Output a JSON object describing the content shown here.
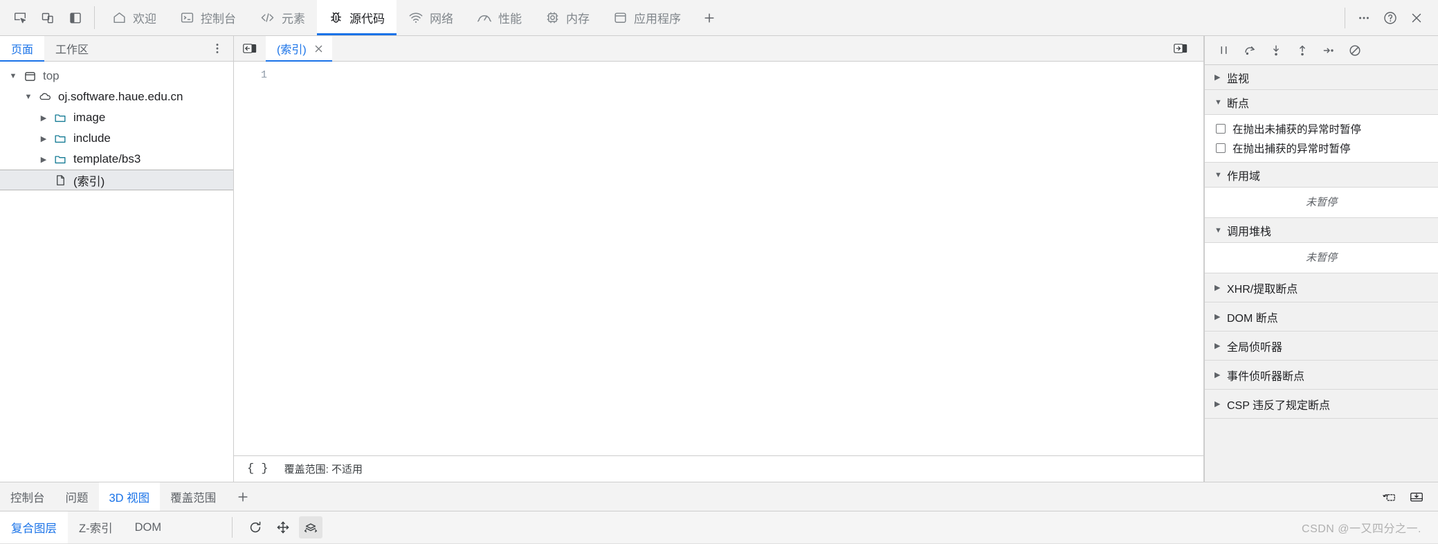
{
  "window": {
    "device_toolbar_icons": [
      "inspect-element-icon",
      "device-toolbar-icon",
      "dock-side-icon"
    ],
    "more_label": "⋯",
    "help_label": "?",
    "close_label": "×"
  },
  "panel_tabs": [
    {
      "label": "欢迎",
      "icon": "home-icon",
      "active": false
    },
    {
      "label": "控制台",
      "icon": "console-icon",
      "active": false
    },
    {
      "label": "元素",
      "icon": "elements-icon",
      "active": false
    },
    {
      "label": "源代码",
      "icon": "sources-bug-icon",
      "active": true
    },
    {
      "label": "网络",
      "icon": "network-wifi-icon",
      "active": false
    },
    {
      "label": "性能",
      "icon": "performance-gauge-icon",
      "active": false
    },
    {
      "label": "内存",
      "icon": "memory-chip-icon",
      "active": false
    },
    {
      "label": "应用程序",
      "icon": "application-icon",
      "active": false
    }
  ],
  "add_panel_label": "+",
  "navigator": {
    "tabs": [
      {
        "label": "页面",
        "active": true
      },
      {
        "label": "工作区",
        "active": false
      }
    ],
    "kebab_label": "⋮",
    "tree": [
      {
        "label": "top",
        "icon": "frame-icon",
        "twisty": "▼",
        "indent": 0,
        "selected": false,
        "muted": true
      },
      {
        "label": "oj.software.haue.edu.cn",
        "icon": "cloud-icon",
        "twisty": "▼",
        "indent": 1,
        "selected": false,
        "muted": false
      },
      {
        "label": "image",
        "icon": "folder-icon",
        "twisty": "▶",
        "indent": 2,
        "selected": false,
        "muted": false
      },
      {
        "label": "include",
        "icon": "folder-icon",
        "twisty": "▶",
        "indent": 2,
        "selected": false,
        "muted": false
      },
      {
        "label": "template/bs3",
        "icon": "folder-icon",
        "twisty": "▶",
        "indent": 2,
        "selected": false,
        "muted": false
      },
      {
        "label": "(索引)",
        "icon": "document-icon",
        "twisty": "",
        "indent": 3,
        "selected": true,
        "muted": false
      }
    ]
  },
  "editor": {
    "navigator_toggle_icon": "show-navigator-icon",
    "tab": {
      "label": "(索引)",
      "close_label": "×",
      "active": true
    },
    "split_toggle_icon": "show-debugger-icon",
    "line_numbers": [
      "1"
    ],
    "lines": [
      ""
    ],
    "status": {
      "format_label": "{ }",
      "coverage_label": "覆盖范围: 不适用"
    }
  },
  "debugger": {
    "toolbar": [
      {
        "icon": "pause-resume-icon",
        "name": "resume-script-execution"
      },
      {
        "icon": "step-over-icon",
        "name": "step-over-next-function-call"
      },
      {
        "icon": "step-into-icon",
        "name": "step-into-next-function-call"
      },
      {
        "icon": "step-out-icon",
        "name": "step-out-of-current-function"
      },
      {
        "icon": "step-icon",
        "name": "step"
      },
      {
        "icon": "deactivate-breakpoints-icon",
        "name": "deactivate-breakpoints"
      }
    ],
    "sections": [
      {
        "label": "监视",
        "twisty": "▶",
        "expanded": false,
        "content": null
      },
      {
        "label": "断点",
        "twisty": "▼",
        "expanded": true,
        "content": "checkboxes"
      },
      {
        "label": "作用域",
        "twisty": "▼",
        "expanded": true,
        "content": "empty"
      },
      {
        "label": "调用堆栈",
        "twisty": "▼",
        "expanded": true,
        "content": "empty"
      },
      {
        "label": "XHR/提取断点",
        "twisty": "▶",
        "expanded": false,
        "content": null
      },
      {
        "label": "DOM 断点",
        "twisty": "▶",
        "expanded": false,
        "content": null
      },
      {
        "label": "全局侦听器",
        "twisty": "▶",
        "expanded": false,
        "content": null
      },
      {
        "label": "事件侦听器断点",
        "twisty": "▶",
        "expanded": false,
        "content": null
      },
      {
        "label": "CSP 违反了规定断点",
        "twisty": "▶",
        "expanded": false,
        "content": null
      }
    ],
    "breakpoint_options": [
      {
        "label": "在抛出未捕获的异常时暂停",
        "checked": false
      },
      {
        "label": "在抛出捕获的异常时暂停",
        "checked": false
      }
    ],
    "empty_text": "未暂停"
  },
  "drawer": {
    "tabs": [
      {
        "label": "控制台",
        "active": false
      },
      {
        "label": "问题",
        "active": false
      },
      {
        "label": "3D 视图",
        "active": true
      },
      {
        "label": "覆盖范围",
        "active": false
      }
    ],
    "add_label": "+",
    "right_icons": [
      "restore-drawer-icon",
      "dock-to-bottom-icon"
    ],
    "sub_tabs": [
      {
        "label": "复合图层",
        "active": true
      },
      {
        "label": "Z-索引",
        "active": false
      },
      {
        "label": "DOM",
        "active": false
      }
    ],
    "tools": [
      {
        "icon": "reset-view-icon",
        "name": "reset-view",
        "on": false
      },
      {
        "icon": "pan-icon",
        "name": "pan-mode",
        "on": false
      },
      {
        "icon": "rotate-layers-icon",
        "name": "rotate-mode",
        "on": true
      }
    ],
    "watermark": "CSDN @一又四分之一."
  },
  "colors": {
    "accent": "#1a73e8",
    "folder": "#1a73a7",
    "chrome_bg": "#f3f3f3",
    "border": "#cdcdcd",
    "muted_text": "#5f6368"
  }
}
